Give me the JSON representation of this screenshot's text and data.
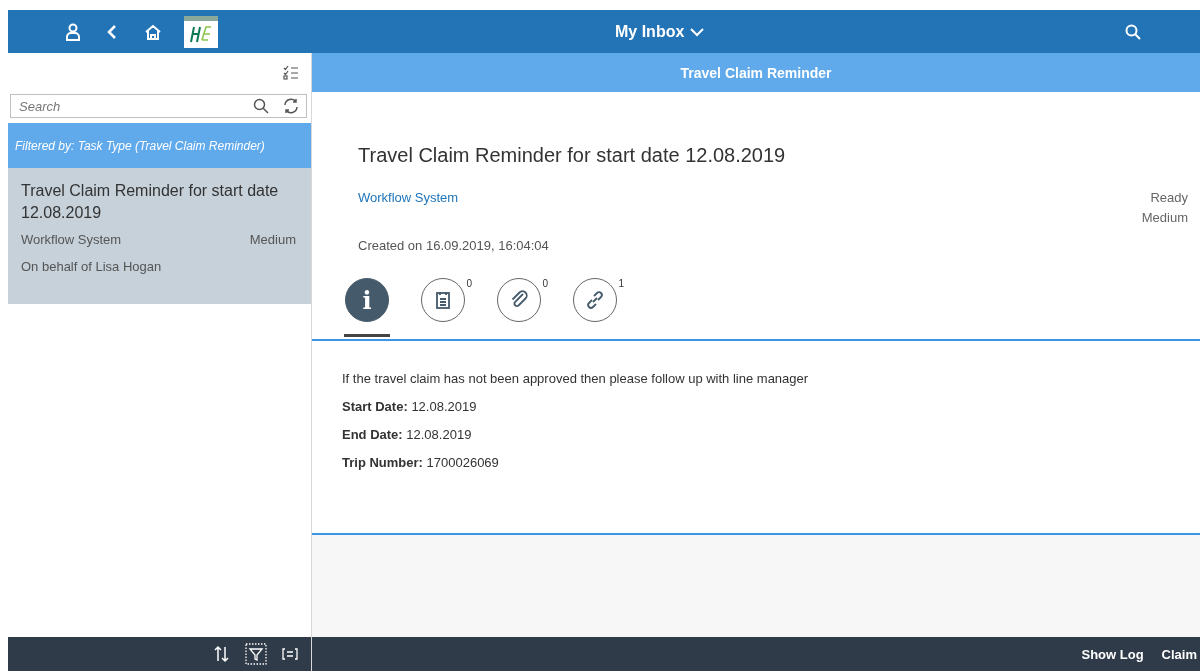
{
  "header": {
    "title": "My Inbox"
  },
  "list": {
    "search": {
      "placeholder": "Search"
    },
    "filter": "Filtered by: Task Type (Travel Claim Reminder)",
    "items": [
      {
        "title": "Travel Claim Reminder for start date 12.08.2019",
        "creator": "Workflow System",
        "priority": "Medium",
        "behalf": "On behalf of Lisa Hogan",
        "selected": true
      }
    ]
  },
  "detail": {
    "header": "Travel Claim Reminder",
    "title": "Travel Claim Reminder for start date 12.08.2019",
    "creator": "Workflow System",
    "status": "Ready",
    "priority": "Medium",
    "created": "Created on 16.09.2019, 16:04:04",
    "tabs": [
      {
        "kind": "info",
        "label": "i",
        "selected": true
      },
      {
        "kind": "notes",
        "count": "0",
        "selected": false
      },
      {
        "kind": "attachments",
        "count": "0",
        "selected": false
      },
      {
        "kind": "links",
        "count": "1",
        "selected": false
      }
    ],
    "description": "If the travel claim has not been approved then please follow up with line manager",
    "fields": [
      {
        "label": "Start Date:",
        "value": "12.08.2019"
      },
      {
        "label": "End Date:",
        "value": "12.08.2019"
      },
      {
        "label": "Trip Number:",
        "value": "1700026069"
      }
    ]
  },
  "footer": {
    "actions": [
      "Show Log",
      "Claim"
    ]
  }
}
